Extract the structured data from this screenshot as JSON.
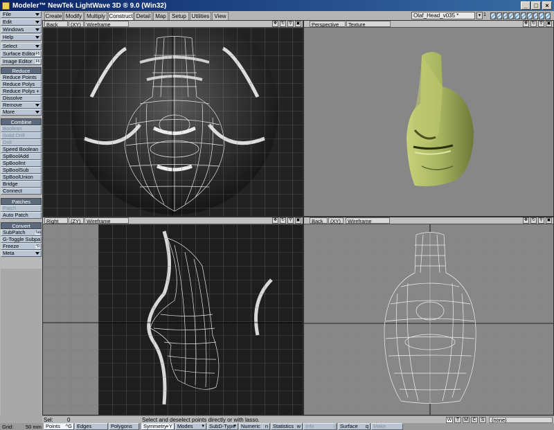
{
  "window": {
    "title": "Modeler™ NewTek LightWave 3D ® 9.0 (Win32)",
    "min": "_",
    "max": "□",
    "close": "×"
  },
  "tabs": [
    "Create",
    "Modify",
    "Multiply",
    "Construct",
    "Detail",
    "Map",
    "Setup",
    "Utilities",
    "View"
  ],
  "active_tab": "Construct",
  "object_selector": "Olaf_Head_v035 *",
  "layer_number": "1",
  "sidebar": {
    "top_menus": [
      "File",
      "Edit",
      "Windows",
      "Help"
    ],
    "select": "Select",
    "surface_editor": "Surface Editor",
    "image_editor": "Image Editor",
    "key_f5": "F5",
    "key_f6": "F6",
    "reduce_header": "Reduce",
    "reduce_items": [
      "Reduce Points",
      "Reduce Polys",
      "Reduce Polys +",
      "Dissolve",
      "Remove",
      "More"
    ],
    "combine_header": "Combine",
    "combine_items": [
      "Boolean",
      "Solid Drill",
      "Drill",
      "Speed Boolean",
      "SpBoolAdd",
      "SpBoolInt",
      "SpBoolSub",
      "SpBoolUnion",
      "Bridge",
      "Connect"
    ],
    "patches_header": "Patches",
    "patches_items": [
      "Patch",
      "Auto Patch"
    ],
    "convert_header": "Convert",
    "convert_items": [
      "SubPatch",
      "G-Toggle Subpa...",
      "Freeze",
      "Meta"
    ],
    "key_tab": "Tab",
    "key_ctrl_d": "^D"
  },
  "viewports": {
    "tl": {
      "view": "Back",
      "axis": "(XY)",
      "mode": "Wireframe"
    },
    "tr": {
      "view": "Perspective",
      "mode": "Texture"
    },
    "bl": {
      "view": "Right",
      "axis": "(ZY)",
      "mode": "Wireframe"
    },
    "br": {
      "view": "Back",
      "axis": "(XY)",
      "mode": "Wireframe"
    }
  },
  "status": {
    "sel_label": "Sel:",
    "sel_value": "0",
    "hint": "Select and deselect points directly or with lasso.",
    "view_modes": [
      "W",
      "T",
      "M",
      "C",
      "S"
    ],
    "surface_value": "(none)"
  },
  "bottom": {
    "grid_label": "Grid:",
    "grid_value": "50 mm",
    "points": "Points",
    "points_key": "^G",
    "edges": "Edges",
    "polygons": "Polygons",
    "symmetry": "Symmetry",
    "symmetry_key": "+Y",
    "modes": "Modes",
    "subd_type": "SubD-Type",
    "numeric": "Numeric",
    "numeric_key": "n",
    "statistics": "Statistics",
    "statistics_key": "w",
    "info": "Info",
    "info_key": "i",
    "surface": "Surface",
    "surface_key": "q",
    "make": "Make"
  },
  "colors": {
    "sidebar_button": "#b9c5d2",
    "sidebar_header": "#5c6a7c",
    "mesh_green": "#a7b460",
    "viewport_gray": "#878787"
  }
}
